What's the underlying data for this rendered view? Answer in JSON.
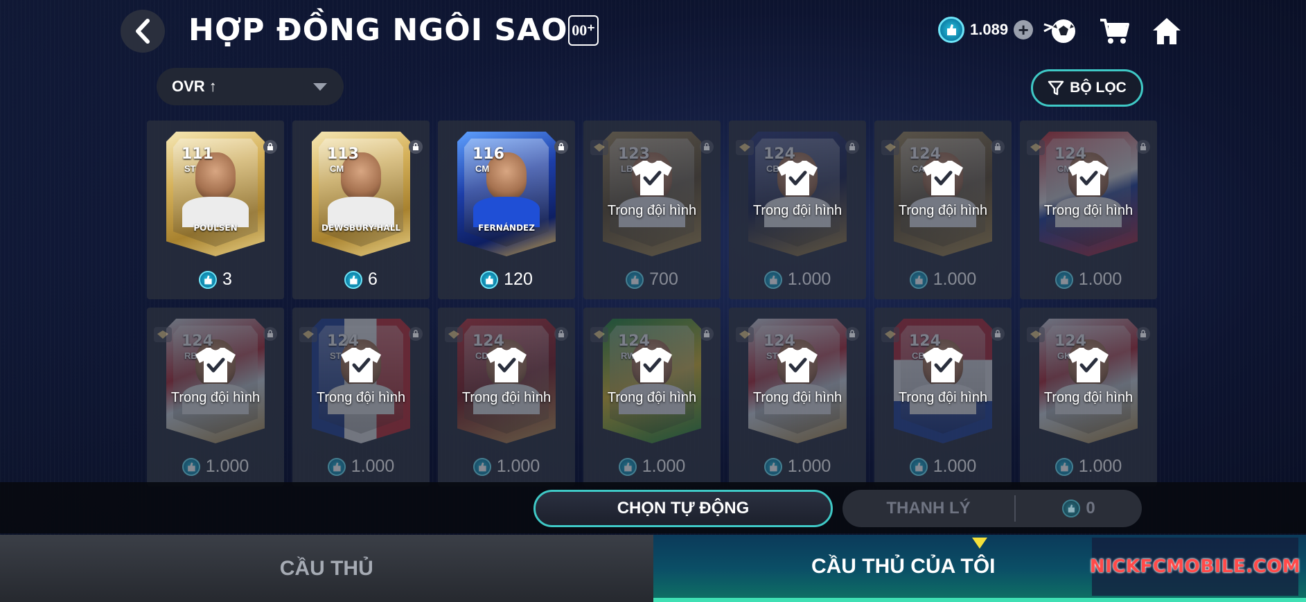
{
  "header": {
    "title": "HỢP ĐỒNG NGÔI SAO",
    "badge": "00⁺",
    "currency_amount": "1.089",
    "back_icon": "chevron-left-icon",
    "icons": [
      "coin-icon",
      "plus-icon",
      "soccer-ball-icon",
      "cart-icon",
      "home-icon"
    ]
  },
  "controls": {
    "sort_label": "OVR ↑",
    "filter_label": "BỘ LỌC"
  },
  "players": [
    {
      "ovr": "111",
      "pos": "ST",
      "name": "POULSEN",
      "price": "3",
      "in_squad": false,
      "style": "gold"
    },
    {
      "ovr": "113",
      "pos": "CM",
      "name": "DEWSBURY-HALL",
      "price": "6",
      "in_squad": false,
      "style": "gold"
    },
    {
      "ovr": "116",
      "pos": "CM",
      "name": "FERNÁNDEZ",
      "price": "120",
      "in_squad": false,
      "style": "blue"
    },
    {
      "ovr": "123",
      "pos": "LB",
      "name": "",
      "price": "700",
      "in_squad": true,
      "style": "gold-dark"
    },
    {
      "ovr": "124",
      "pos": "CB",
      "name": "",
      "price": "1.000",
      "in_squad": true,
      "style": "navy"
    },
    {
      "ovr": "124",
      "pos": "CAM",
      "name": "",
      "price": "1.000",
      "in_squad": true,
      "style": "gold-dark"
    },
    {
      "ovr": "124",
      "pos": "CM",
      "name": "",
      "price": "1.000",
      "in_squad": true,
      "style": "flag-no"
    },
    {
      "ovr": "124",
      "pos": "RB",
      "name": "",
      "price": "1.000",
      "in_squad": true,
      "style": "flag-dk"
    },
    {
      "ovr": "124",
      "pos": "ST",
      "name": "",
      "price": "1.000",
      "in_squad": true,
      "style": "flag-fr"
    },
    {
      "ovr": "124",
      "pos": "CDM",
      "name": "",
      "price": "1.000",
      "in_squad": true,
      "style": "red"
    },
    {
      "ovr": "124",
      "pos": "RW",
      "name": "",
      "price": "1.000",
      "in_squad": true,
      "style": "flag-br"
    },
    {
      "ovr": "124",
      "pos": "ST",
      "name": "",
      "price": "1.000",
      "in_squad": true,
      "style": "flag-dk"
    },
    {
      "ovr": "124",
      "pos": "CB",
      "name": "",
      "price": "1.000",
      "in_squad": true,
      "style": "flag-nl"
    },
    {
      "ovr": "124",
      "pos": "GK",
      "name": "",
      "price": "1.000",
      "in_squad": true,
      "style": "flag-dk"
    }
  ],
  "in_squad_label": "Trong đội hình",
  "actions": {
    "auto_select": "CHỌN TỰ ĐỘNG",
    "sell": "THANH LÝ",
    "sell_amount": "0"
  },
  "tabs": {
    "players": "CẦU THỦ",
    "my_players": "CẦU THỦ CỦA TÔI"
  },
  "watermark": "NICKFCMOBILE.COM",
  "colors": {
    "accent": "#3fc9c6",
    "coin": "#27c3e0",
    "tab_marker": "#f4e03a"
  }
}
